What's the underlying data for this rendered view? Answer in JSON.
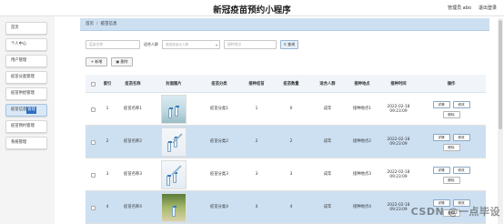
{
  "header": {
    "title": "新冠疫苗预约小程序",
    "admin_label": "管理员 abo",
    "logout_label": "退出登录"
  },
  "sidebar": {
    "items": [
      {
        "label": "首页"
      },
      {
        "label": "个人中心"
      },
      {
        "label": "用户管理"
      },
      {
        "label": "疫苗分类管理"
      },
      {
        "label": "疫苗供给管理"
      },
      {
        "label": "疫苗信息",
        "highlight": "管理"
      },
      {
        "label": "疫苗预约管理"
      },
      {
        "label": "系统管理"
      }
    ]
  },
  "breadcrumb": {
    "home": "首页",
    "sep": "/",
    "current": "疫苗信息"
  },
  "search": {
    "name_placeholder": "疫苗名称",
    "crowd_label": "适合人群",
    "crowd_placeholder": "请选择适合人群",
    "place_placeholder": "接种地点",
    "search_button": "查询"
  },
  "actions": {
    "add_label": "+ 新增",
    "delete_label": "删除"
  },
  "table": {
    "headers": [
      "索引",
      "疫苗名称",
      "封面图片",
      "疫苗分类",
      "接种疫苗",
      "疫苗数量",
      "适合人群",
      "接种地点",
      "接种时间",
      "操作"
    ],
    "rows": [
      {
        "index": "1",
        "name": "疫苗名称1",
        "category": "疫苗分类1",
        "dose": "1",
        "qty": "0",
        "crowd": "成年",
        "place": "接种地点1",
        "time": "2022-02-18 09:23:09"
      },
      {
        "index": "2",
        "name": "疫苗名称2",
        "category": "疫苗分类2",
        "dose": "2",
        "qty": "2",
        "crowd": "成年",
        "place": "接种地点2",
        "time": "2022-02-18 09:23:09"
      },
      {
        "index": "3",
        "name": "疫苗名称3",
        "category": "疫苗分类3",
        "dose": "3",
        "qty": "3",
        "crowd": "成年",
        "place": "接种地点3",
        "time": "2022-02-18 09:23:09"
      },
      {
        "index": "4",
        "name": "疫苗名称4",
        "category": "疫苗分类4",
        "dose": "4",
        "qty": "4",
        "crowd": "成年",
        "place": "接种地点4",
        "time": "2022-02-18 09:23:09"
      }
    ],
    "op_detail": "详情",
    "op_edit": "修改",
    "op_delete": "删除"
  },
  "watermark": "CSDN @一点毕设",
  "icons": {
    "caret": "chevron-down-icon",
    "search": "search-icon",
    "checkbox": "checkbox-icon"
  }
}
